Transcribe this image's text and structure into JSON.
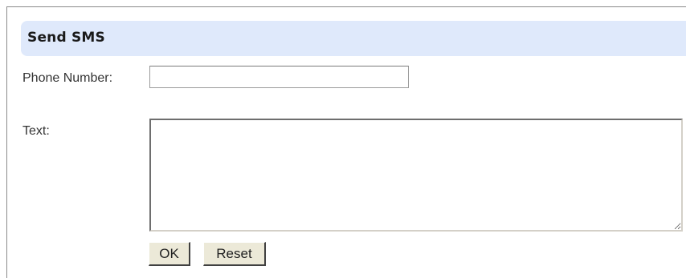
{
  "section": {
    "title": "Send SMS"
  },
  "form": {
    "phone_label": "Phone Number:",
    "phone_value": "",
    "text_label": "Text:",
    "text_value": ""
  },
  "buttons": {
    "ok_label": "OK",
    "reset_label": "Reset"
  },
  "colors": {
    "header_background": "#dfe9fb",
    "button_background": "#ece9d8"
  }
}
